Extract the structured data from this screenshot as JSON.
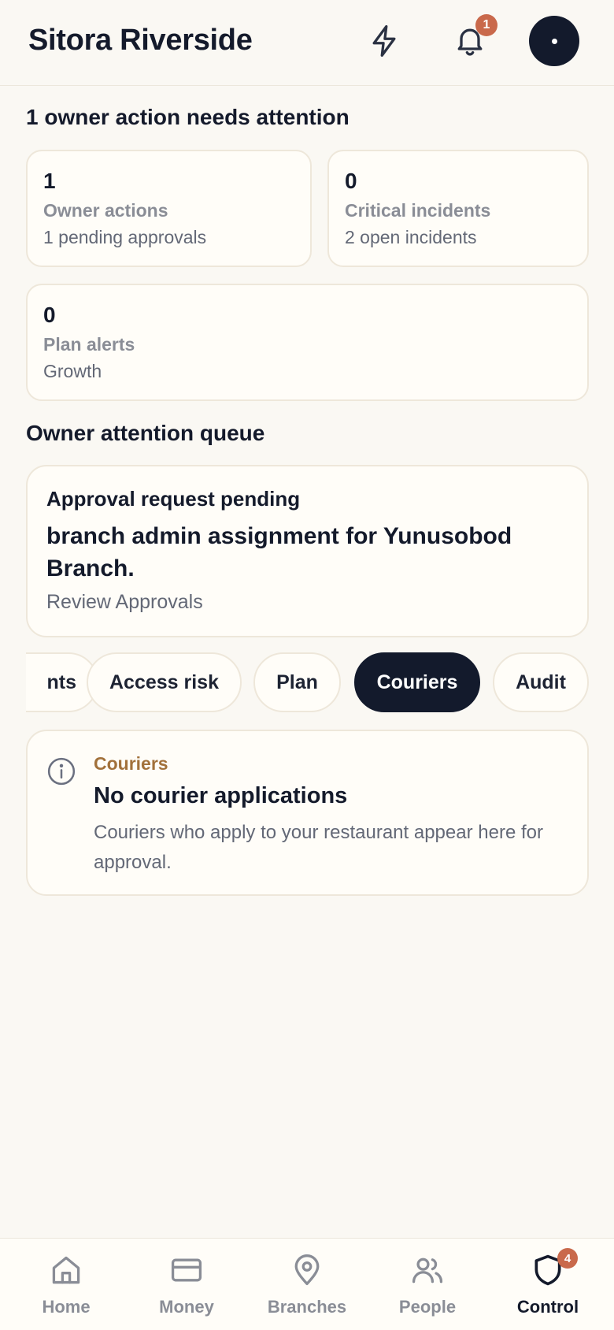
{
  "header": {
    "title": "Sitora Riverside",
    "notification_count": "1"
  },
  "summary": {
    "heading": "1 owner action needs attention",
    "cards": [
      {
        "value": "1",
        "label": "Owner actions",
        "sub": "1 pending approvals"
      },
      {
        "value": "0",
        "label": "Critical incidents",
        "sub": "2 open incidents"
      },
      {
        "value": "0",
        "label": "Plan alerts",
        "sub": "Growth"
      }
    ]
  },
  "queue": {
    "heading": "Owner attention queue",
    "item": {
      "kicker": "Approval request pending",
      "title": "branch admin assignment for Yunusobod Branch.",
      "link": "Review Approvals"
    }
  },
  "chips": {
    "items": [
      "nts",
      "Access risk",
      "Plan",
      "Couriers",
      "Audit"
    ],
    "active": "Couriers"
  },
  "couriers_panel": {
    "kicker": "Couriers",
    "title": "No courier applications",
    "body": "Couriers who apply to your restaurant appear here for approval."
  },
  "nav": {
    "items": [
      {
        "label": "Home",
        "icon": "home-icon"
      },
      {
        "label": "Money",
        "icon": "wallet-icon"
      },
      {
        "label": "Branches",
        "icon": "map-pin-icon"
      },
      {
        "label": "People",
        "icon": "users-icon"
      },
      {
        "label": "Control",
        "icon": "shield-icon",
        "badge": "4"
      }
    ],
    "active": "Control"
  },
  "colors": {
    "background": "#faf8f3",
    "ink": "#141a2b",
    "badge": "#c9694b",
    "accent_kicker": "#a2713b"
  }
}
